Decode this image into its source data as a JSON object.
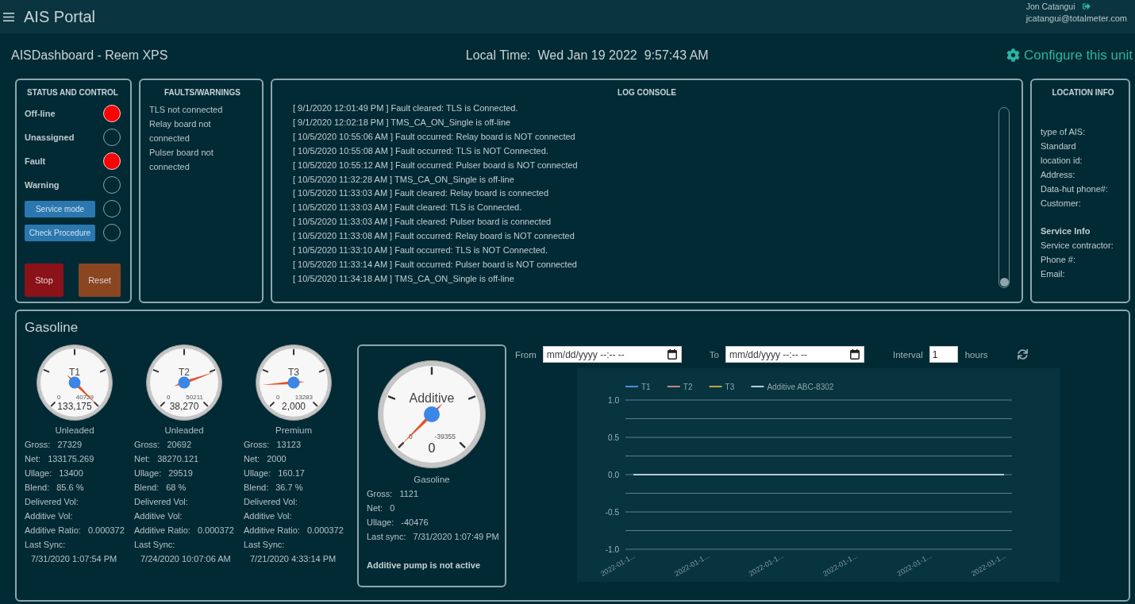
{
  "header": {
    "title": "AIS Portal",
    "user_name": "Jon Catangui",
    "user_email": "jcatangui@totalmeter.com"
  },
  "subheader": {
    "title": "AISDashboard - Reem XPS",
    "local_time_label": "Local Time:",
    "local_date": "Wed Jan 19 2022",
    "local_time": "9:57:43 AM",
    "configure_link": "Configure this unit"
  },
  "status_panel": {
    "title": "STATUS AND CONTROL",
    "items": [
      {
        "kind": "label",
        "label": "Off-line",
        "on": true
      },
      {
        "kind": "label",
        "label": "Unassigned",
        "on": false
      },
      {
        "kind": "label",
        "label": "Fault",
        "on": true
      },
      {
        "kind": "label",
        "label": "Warning",
        "on": false
      },
      {
        "kind": "button",
        "label": "Service mode",
        "on": false
      },
      {
        "kind": "button",
        "label": "Check Procedure",
        "on": false
      }
    ],
    "actions": [
      {
        "kind": "stop",
        "label": "Stop"
      },
      {
        "kind": "reset",
        "label": "Reset"
      }
    ]
  },
  "faults_panel": {
    "title": "FAULTS/WARNINGS",
    "items": [
      "TLS not connected",
      "Relay board not connected",
      "Pulser board not connected"
    ]
  },
  "log_console": {
    "title": "LOG CONSOLE",
    "lines": [
      "[ 9/1/2020 12:01:49 PM ] Fault cleared: TLS is Connected.",
      "[ 9/1/2020 12:02:18 PM ] TMS_CA_ON_Single is off-line",
      "[ 10/5/2020 10:55:06 AM ] Fault occurred: Relay board is NOT connected",
      "[ 10/5/2020 10:55:08 AM ] Fault occurred: TLS is NOT Connected.",
      "[ 10/5/2020 10:55:12 AM ] Fault occurred: Pulser board is NOT connected",
      "[ 10/5/2020 11:32:28 AM ] TMS_CA_ON_Single is off-line",
      "[ 10/5/2020 11:33:03 AM ] Fault cleared: Relay board is connected",
      "[ 10/5/2020 11:33:03 AM ] Fault cleared: TLS is Connected.",
      "[ 10/5/2020 11:33:03 AM ] Fault cleared: Pulser board is connected",
      "[ 10/5/2020 11:33:08 AM ] Fault occurred: Relay board is NOT connected",
      "[ 10/5/2020 11:33:10 AM ] Fault occurred: TLS is NOT Connected.",
      "[ 10/5/2020 11:33:14 AM ] Fault occurred: Pulser board is NOT connected",
      "[ 10/5/2020 11:34:18 AM ] TMS_CA_ON_Single is off-line"
    ]
  },
  "location_info": {
    "title": "LOCATION INFO",
    "fields": [
      "type of AIS:",
      "Standard",
      "location id:",
      "Address:",
      "Data-hut phone#:",
      "Customer:"
    ],
    "service_title": "Service Info",
    "service_fields": [
      "Service contractor:",
      "Phone #:",
      "Email:"
    ]
  },
  "gasoline": {
    "title": "Gasoline",
    "tanks": [
      {
        "gauge": {
          "label": "T1",
          "min": "0",
          "max": "40729",
          "value": "133,175"
        },
        "product": "Unleaded",
        "stats": [
          {
            "label": "Gross:",
            "value": "27329"
          },
          {
            "label": "Net:",
            "value": "133175.269"
          },
          {
            "label": "Ullage:",
            "value": "13400"
          },
          {
            "label": "Blend:",
            "value": "85.6 %"
          },
          {
            "label": "Delivered Vol:"
          },
          {
            "label": "Additive Vol:"
          },
          {
            "label": "Additive Ratio:",
            "value": "0.000372"
          }
        ],
        "last_sync": {
          "label": "Last Sync:",
          "value": "7/31/2020 1:07:54 PM"
        }
      },
      {
        "gauge": {
          "label": "T2",
          "min": "0",
          "max": "50211",
          "value": "38,270"
        },
        "product": "Unleaded",
        "stats": [
          {
            "label": "Gross:",
            "value": "20692"
          },
          {
            "label": "Net:",
            "value": "38270.121"
          },
          {
            "label": "Ullage:",
            "value": "29519"
          },
          {
            "label": "Blend:",
            "value": "68 %"
          },
          {
            "label": "Delivered Vol:"
          },
          {
            "label": "Additive Vol:"
          },
          {
            "label": "Additive Ratio:",
            "value": "0.000372"
          }
        ],
        "last_sync": {
          "label": "Last Sync:",
          "value": "7/24/2020 10:07:06 AM"
        }
      },
      {
        "gauge": {
          "label": "T3",
          "min": "0",
          "max": "13283",
          "value": "2,000"
        },
        "product": "Premium",
        "stats": [
          {
            "label": "Gross:",
            "value": "13123"
          },
          {
            "label": "Net:",
            "value": "2000"
          },
          {
            "label": "Ullage:",
            "value": "160.17"
          },
          {
            "label": "Blend:",
            "value": "36.7 %"
          },
          {
            "label": "Delivered Vol:"
          },
          {
            "label": "Additive Vol:"
          },
          {
            "label": "Additive Ratio:",
            "value": "0.000372"
          }
        ],
        "last_sync": {
          "label": "Last Sync:",
          "value": "7/21/2020 4:33:14 PM"
        }
      }
    ],
    "additive": {
      "gauge": {
        "label": "Additive",
        "min": "0",
        "max": "-39355",
        "value": "0"
      },
      "product": "Gasoline",
      "stats": [
        {
          "label": "Gross:",
          "value": "1121"
        },
        {
          "label": "Net:",
          "value": "0"
        },
        {
          "label": "Ullage:",
          "value": "-40476"
        },
        {
          "label": "Last sync:",
          "value": "7/31/2020 1:07:49 PM"
        }
      ],
      "pump_status": "Additive pump is not active"
    },
    "filters": {
      "from_label": "From",
      "from_placeholder": "mm/dd/yyyy --:-- --",
      "to_label": "To",
      "to_placeholder": "mm/dd/yyyy --:-- --",
      "interval_label": "Interval",
      "interval_value": "1",
      "interval_unit": "hours"
    },
    "chart_data": {
      "type": "line",
      "legend": "top",
      "grid": true,
      "categories": [
        "2022-01-1...",
        "2022-01-1...",
        "2022-01-1...",
        "2022-01-1...",
        "2022-01-1...",
        "2022-01-1..."
      ],
      "series": [
        {
          "name": "T1",
          "color": "#4a90d9",
          "values": [
            null,
            null,
            null,
            null,
            null,
            null
          ]
        },
        {
          "name": "T2",
          "color": "#c98484",
          "values": [
            null,
            null,
            null,
            null,
            null,
            null
          ]
        },
        {
          "name": "T3",
          "color": "#b8a83a",
          "values": [
            null,
            null,
            null,
            null,
            null,
            null
          ]
        },
        {
          "name": "Additive ABC-8302",
          "color": "#b4cdd6",
          "values": [
            0,
            0,
            0,
            0,
            0,
            0
          ]
        }
      ],
      "ylim": [
        -1,
        1
      ],
      "yticks": [
        {
          "value": -1,
          "label": "-1.0"
        },
        {
          "value": -0.5,
          "label": "-0.5"
        },
        {
          "value": 0,
          "label": "0.0"
        },
        {
          "value": 0.5,
          "label": "0.5"
        },
        {
          "value": 1,
          "label": "1.0"
        }
      ]
    }
  }
}
